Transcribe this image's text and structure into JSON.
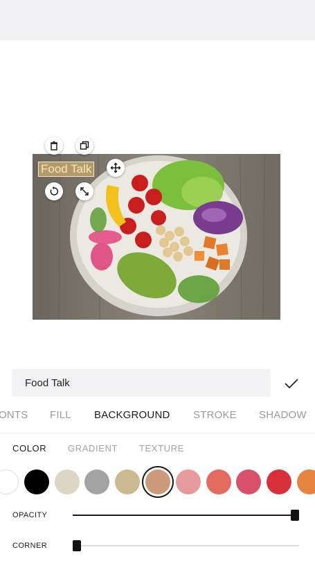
{
  "editor": {
    "sticker_text": "Food Talk",
    "text_value": "Food Talk"
  },
  "tabs": [
    "ONTS",
    "FILL",
    "BACKGROUND",
    "STROKE",
    "SHADOW"
  ],
  "active_tab": "BACKGROUND",
  "sub_tabs": [
    "COLOR",
    "GRADIENT",
    "TEXTURE"
  ],
  "active_sub_tab": "COLOR",
  "swatches": [
    "#ffffff",
    "#000000",
    "#ddd6c4",
    "#a3a3a3",
    "#cdb894",
    "#cd9a7c",
    "#e59a9c",
    "#e26a5e",
    "#d9506a",
    "#d8303a",
    "#e6833f"
  ],
  "selected_swatch": 5,
  "sliders": {
    "opacity_label": "OPACITY",
    "opacity_value": 1.0,
    "corner_label": "CORNER",
    "corner_value": 0.0
  },
  "icons": {
    "delete": "trash-icon",
    "duplicate": "duplicate-icon",
    "move": "move-icon",
    "rotate": "rotate-icon",
    "resize": "resize-icon",
    "confirm": "checkmark-icon"
  }
}
